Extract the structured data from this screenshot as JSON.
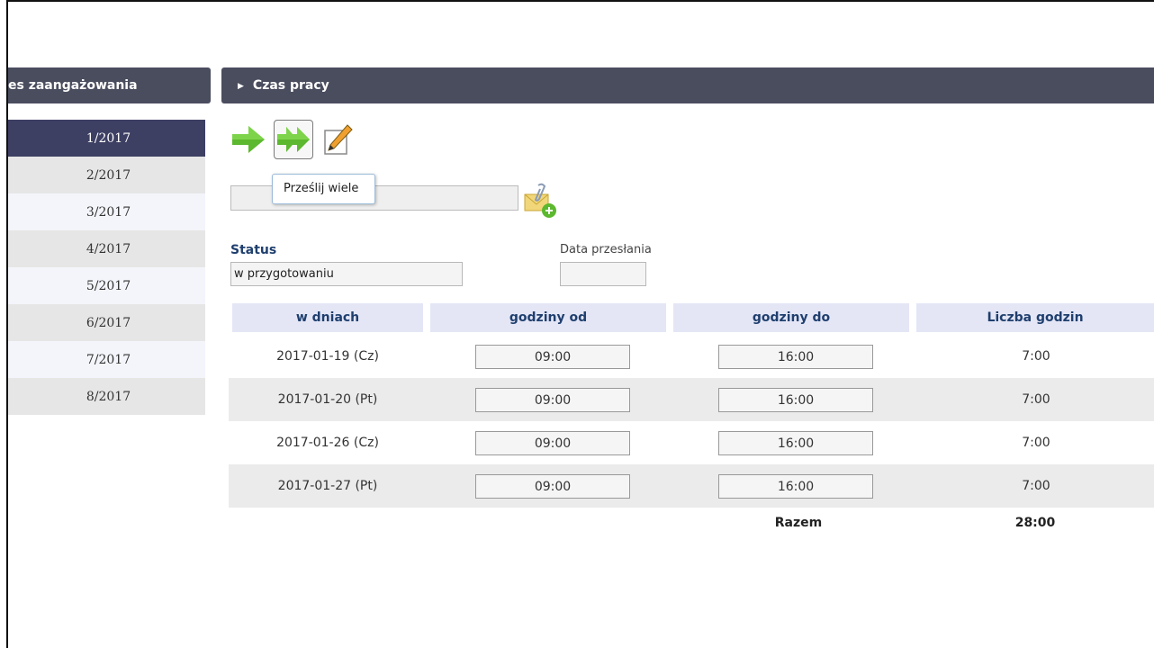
{
  "left_panel": {
    "header": "es zaangażowania",
    "periods": [
      {
        "label": "1/2017",
        "active": true
      },
      {
        "label": "2/2017"
      },
      {
        "label": "3/2017"
      },
      {
        "label": "4/2017"
      },
      {
        "label": "5/2017"
      },
      {
        "label": "6/2017"
      },
      {
        "label": "7/2017"
      },
      {
        "label": "8/2017"
      }
    ]
  },
  "main": {
    "header": "Czas pracy",
    "toolbar": {
      "icons": [
        "send-arrow-icon",
        "send-many-icon",
        "edit-pencil-icon"
      ],
      "tooltip": "Prześlij wiele"
    },
    "attachment": {
      "value": "",
      "icon": "attach-file-icon"
    },
    "status": {
      "label": "Status",
      "value": "w przygotowaniu"
    },
    "date_sent": {
      "label": "Data przesłania",
      "value": ""
    },
    "table": {
      "headers": [
        "w dniach",
        "godziny od",
        "godziny do",
        "Liczba godzin"
      ],
      "rows": [
        {
          "date": "2017-01-19 (Cz)",
          "from": "09:00",
          "to": "16:00",
          "hours": "7:00"
        },
        {
          "date": "2017-01-20 (Pt)",
          "from": "09:00",
          "to": "16:00",
          "hours": "7:00"
        },
        {
          "date": "2017-01-26 (Cz)",
          "from": "09:00",
          "to": "16:00",
          "hours": "7:00"
        },
        {
          "date": "2017-01-27 (Pt)",
          "from": "09:00",
          "to": "16:00",
          "hours": "7:00"
        }
      ],
      "total_label": "Razem",
      "total_value": "28:00"
    }
  },
  "colors": {
    "header_bg": "#4a4d5e",
    "active_period": "#3d3f63",
    "table_header_bg": "#e4e6f6",
    "label_blue": "#1f3f6e",
    "arrow_green": "#5cb82e"
  }
}
